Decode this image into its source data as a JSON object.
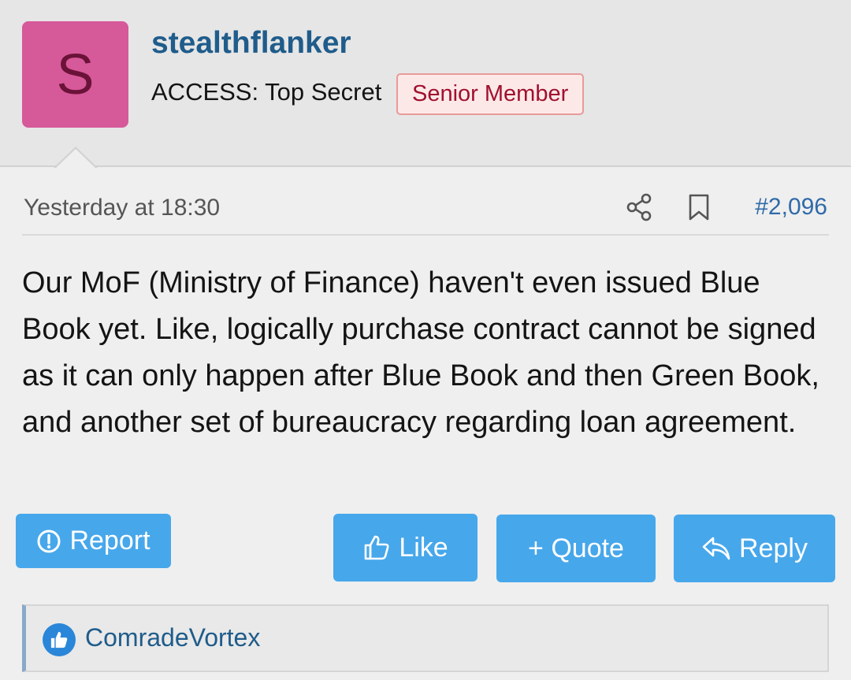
{
  "user": {
    "avatar_letter": "S",
    "avatar_color": "#d6599a",
    "username": "stealthflanker",
    "title": "ACCESS: Top Secret",
    "banner": "Senior Member"
  },
  "post": {
    "timestamp": "Yesterday at 18:30",
    "share_icon": "share-icon",
    "bookmark_icon": "bookmark-icon",
    "number": "#2,096",
    "body": "Our MoF (Ministry of Finance) haven't even issued Blue Book yet. Like, logically purchase contract cannot be signed as it can only happen after Blue Book and then Green Book, and another set of bureaucracy regarding loan agreement."
  },
  "actions": {
    "report_label": "Report",
    "like_label": "Like",
    "quote_label": "+ Quote",
    "reply_label": "Reply",
    "button_color": "#47a7eb"
  },
  "reactions": {
    "icon": "thumbs-up-icon",
    "user": "ComradeVortex"
  }
}
